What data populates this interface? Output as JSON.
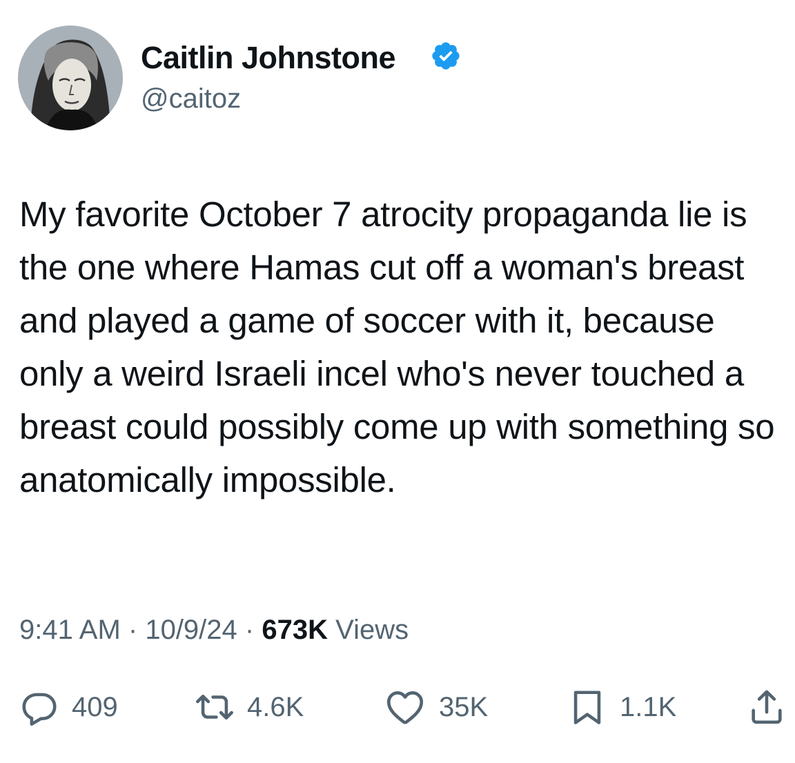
{
  "author": {
    "display_name": "Caitlin Johnstone",
    "handle": "@caitoz",
    "verified": true,
    "avatar_icon": "avatar-portrait"
  },
  "tweet": {
    "text": "My favorite October 7 atrocity propaganda lie is the one where Hamas cut off a woman's breast and played a game of soccer with it, because only a weird Israeli incel who's never touched a breast could possibly come up with something so anatomically impossible."
  },
  "meta": {
    "time": "9:41 AM",
    "separator": "·",
    "date": "10/9/24",
    "views_count": "673K",
    "views_label": "Views"
  },
  "actions": {
    "reply": {
      "icon": "reply-icon",
      "count": "409"
    },
    "retweet": {
      "icon": "retweet-icon",
      "count": "4.6K"
    },
    "like": {
      "icon": "heart-icon",
      "count": "35K"
    },
    "bookmark": {
      "icon": "bookmark-icon",
      "count": "1.1K"
    },
    "share": {
      "icon": "share-icon"
    }
  },
  "colors": {
    "text_primary": "#0f1419",
    "text_secondary": "#536471",
    "verified_blue": "#1d9bf0",
    "background": "#ffffff"
  }
}
